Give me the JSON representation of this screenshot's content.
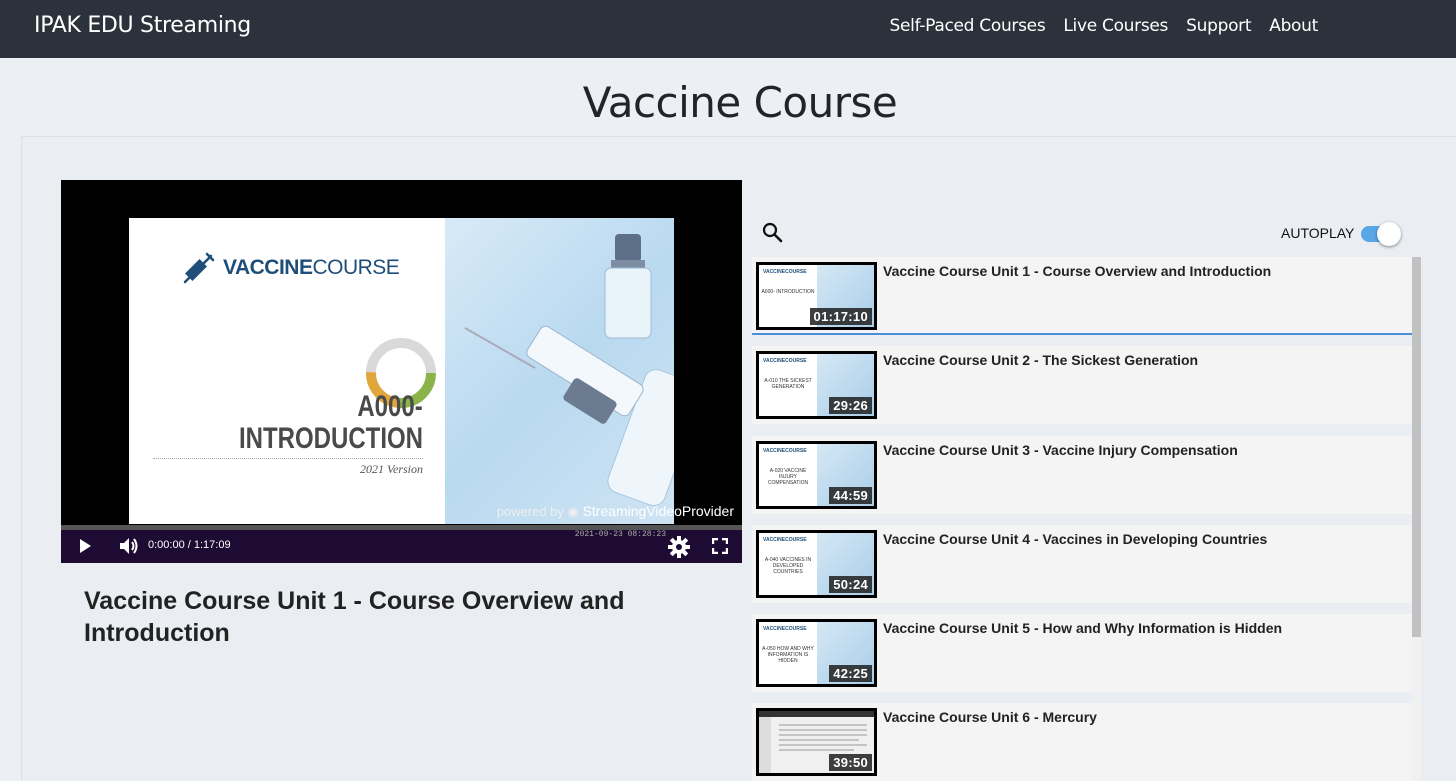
{
  "nav": {
    "brand": "IPAK EDU Streaming",
    "links": [
      "Self-Paced Courses",
      "Live Courses",
      "Support",
      "About"
    ]
  },
  "page": {
    "title": "Vaccine Course"
  },
  "player": {
    "slide_logo_bold": "VACCINE",
    "slide_logo_light": "COURSE",
    "slide_code": "A000-",
    "slide_heading": "INTRODUCTION",
    "slide_version": "2021 Version",
    "watermark_prefix": "powered by",
    "watermark_brand": "StreamingVideoProvider",
    "time": "0:00:00 / 1:17:09",
    "stamp": "2021-09-23 08:28:23",
    "progress": 0
  },
  "current_video": {
    "title": "Vaccine Course Unit 1 - Course Overview and Introduction"
  },
  "playlist_header": {
    "autoplay_label": "AUTOPLAY",
    "autoplay_on": true
  },
  "playlist": [
    {
      "title": "Vaccine Course Unit 1 - Course Overview and Introduction",
      "duration": "01:17:10",
      "thumb_text": "A000- INTRODUCTION",
      "active": true
    },
    {
      "title": "Vaccine Course Unit 2 - The Sickest Generation",
      "duration": "29:26",
      "thumb_text": "A-010 THE SICKEST GENERATION"
    },
    {
      "title": "Vaccine Course Unit 3 - Vaccine Injury Compensation",
      "duration": "44:59",
      "thumb_text": "A-020 VACCINE INJURY COMPENSATION"
    },
    {
      "title": "Vaccine Course Unit 4 - Vaccines in Developing Countries",
      "duration": "50:24",
      "thumb_text": "A-040 VACCINES IN DEVELOPED COUNTRIES"
    },
    {
      "title": "Vaccine Course Unit 5 - How and Why Information is Hidden",
      "duration": "42:25",
      "thumb_text": "A-050 HOW AND WHY INFORMATION IS HIDDEN"
    },
    {
      "title": "Vaccine Course Unit 6 - Mercury",
      "duration": "39:50",
      "thumb_text": ""
    }
  ],
  "thumb_logo": "VACCINECOURSE",
  "colors": {
    "navbar": "#2c323b",
    "accent": "#4a90d9",
    "toggle": "#5aa7e8",
    "controls": "#1e0b33"
  }
}
